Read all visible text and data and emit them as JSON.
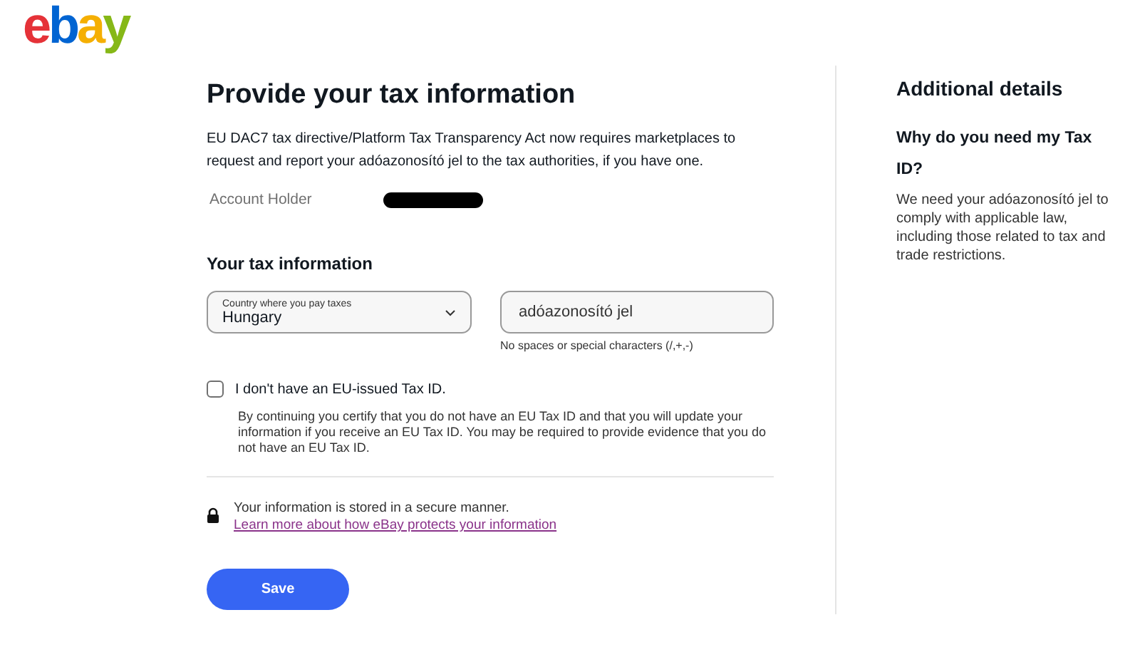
{
  "logo": {
    "letters": [
      {
        "text": "e",
        "color": "#e53238"
      },
      {
        "text": "b",
        "color": "#0064d2"
      },
      {
        "text": "a",
        "color": "#f5af02"
      },
      {
        "text": "y",
        "color": "#86b817"
      }
    ]
  },
  "main": {
    "title": "Provide your tax information",
    "intro": "EU DAC7 tax directive/Platform Tax Transparency Act now requires marketplaces to request and report your adóazonosító jel to the tax authorities, if you have one.",
    "account_holder": {
      "label": "Account Holder",
      "redacted": true
    },
    "section_title": "Your tax information",
    "country": {
      "label": "Country where you pay taxes",
      "value": "Hungary"
    },
    "tax_id": {
      "placeholder": "adóazonosító jel",
      "hint": "No spaces or special characters (/,+,-)"
    },
    "no_tax_id": {
      "label": "I don't have an EU-issued Tax ID.",
      "checked": false,
      "note": "By continuing you certify that you do not have an EU Tax ID and that you will update your information if you receive an EU Tax ID. You may be required to provide evidence that you do not have an EU Tax ID."
    },
    "secure": {
      "text": "Your information is stored in a secure manner.",
      "link": "Learn more about how eBay protects your information"
    },
    "save": "Save"
  },
  "sidebar": {
    "title": "Additional details",
    "question": "Why do you need my Tax ID?",
    "answer": "We need your adóazonosító jel to comply with applicable law, including those related to tax and trade restrictions."
  }
}
